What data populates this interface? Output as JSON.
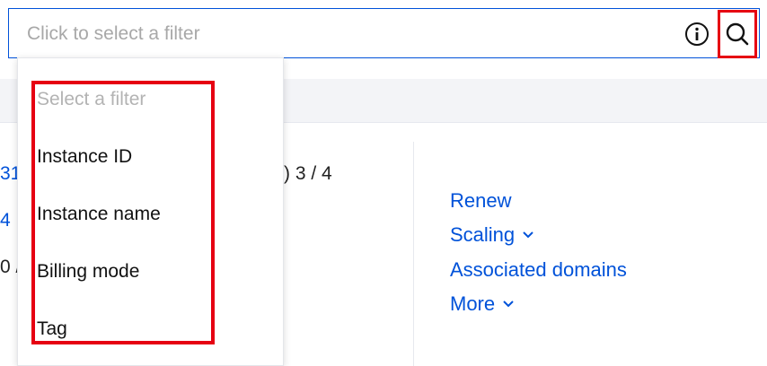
{
  "search": {
    "placeholder": "Click to select a filter",
    "info_icon": "info-circle-icon",
    "search_icon": "magnifier-icon"
  },
  "dropdown": {
    "header": "Select a filter",
    "items": [
      {
        "label": "Instance ID"
      },
      {
        "label": "Instance name"
      },
      {
        "label": "Billing mode"
      },
      {
        "label": "Tag"
      }
    ]
  },
  "table": {
    "left_fragments": [
      "31",
      "4",
      "0 /"
    ],
    "mid_fragment": ") 3 / 4"
  },
  "operations": {
    "renew": "Renew",
    "scaling": "Scaling",
    "associated_domains": "Associated domains",
    "more": "More"
  },
  "colors": {
    "accent": "#0052d9",
    "highlight": "#e60012"
  }
}
